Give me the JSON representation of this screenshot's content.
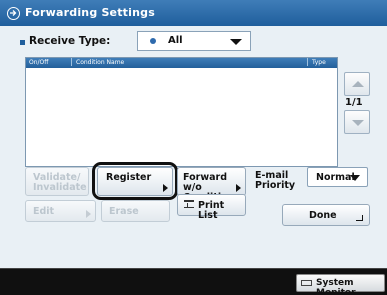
{
  "window": {
    "title": "Forwarding Settings"
  },
  "receive_type": {
    "label": "Receive Type:",
    "selected": "All"
  },
  "list": {
    "columns": [
      "On/Off",
      "Condition Name",
      "Type"
    ],
    "rows": [],
    "page": "1/1"
  },
  "buttons": {
    "validate": "Validate/\nInvalidate",
    "register": "Register",
    "forward": "Forward w/o\nConditions",
    "edit": "Edit",
    "erase": "Erase",
    "print_list": "Print List",
    "done": "Done"
  },
  "email_priority": {
    "label": "E-mail\nPriority",
    "selected": "Normal"
  },
  "taskbar": {
    "system_monitor": "System Monitor"
  },
  "colors": {
    "header_blue": "#1f5e9c",
    "background": "#e9f0f5",
    "taskbar": "#101010"
  }
}
